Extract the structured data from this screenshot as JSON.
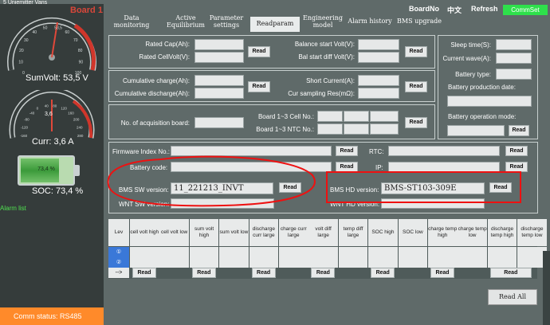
{
  "top_fragment": "5 Uniemitter Vans",
  "left": {
    "board_title": "Board 1",
    "sumvolt_gauge_ticks": [
      "0",
      "10",
      "20",
      "30",
      "40",
      "50",
      "53,5",
      "60",
      "70",
      "80",
      "90",
      "100"
    ],
    "sumvolt_gauge_value": 53.5,
    "sumvolt_label": "SumVolt: 53,5 V",
    "curr_gauge_ticks": [
      "-200",
      "-160",
      "-120",
      "-80",
      "-40",
      "0",
      "40",
      "80",
      "120",
      "160",
      "200",
      "240",
      "280",
      "320"
    ],
    "curr_gauge_center": "3,6",
    "curr_label": "Curr: 3,6 A",
    "battery_text": "73,4 %",
    "soc_fraction": 0.734,
    "soc_label": "SOC: 73,4 %",
    "alarm_list": "Alarm list",
    "comm_status": "Comm status: RS485"
  },
  "tabs": [
    {
      "label": "Data\nmonitoring"
    },
    {
      "label": "Active\nEquilibrium"
    },
    {
      "label": "Parameter\nsettings"
    },
    {
      "label": "Readparam"
    },
    {
      "label": "Engineering\nmodel"
    },
    {
      "label": "Alarm history"
    },
    {
      "label": "BMS upgrade"
    }
  ],
  "header": {
    "boardno": "BoardNo",
    "lang": "中文",
    "refresh": "Refresh",
    "commset": "CommSet"
  },
  "panel1": {
    "rated_cap": "Rated Cap(Ah):",
    "rated_cellvolt": "Rated CellVolt(V):",
    "balance_start": "Balance start Volt(V):",
    "bal_start_diff": "Bal start diff Volt(V):",
    "read": "Read"
  },
  "panel2": {
    "cum_charge": "Cumulative charge(Ah):",
    "cum_discharge": "Cumulative discharge(Ah):",
    "short_current": "Short Current(A):",
    "cur_sampling": "Cur sampling Res(mΩ):",
    "read": "Read"
  },
  "panel3": {
    "no_acq_board": "No. of acquisition board:",
    "board_cell_no": "Board 1~3 Cell No.:",
    "board_ntc_no": "Board 1~3 NTC No.:",
    "read": "Read"
  },
  "right_panel": {
    "sleep_time": "Sleep time(S):",
    "current_wave": "Current wave(A):",
    "battery_type": "Battery type:",
    "production_date": "Battery production date:",
    "operation_mode": "Battery operation mode:",
    "read": "Read"
  },
  "info": {
    "firmware_index": "Firmware Index No.:",
    "battery_code": "Battery code:",
    "bms_sw_version": "BMS SW version:",
    "bms_sw_value": "11_221213_INVT",
    "wnt_sw_version": "WNT SW version:",
    "rtc": "RTC:",
    "ip": "IP:",
    "bms_hd_version": "BMS HD version:",
    "bms_hd_value": "BMS-ST103-309E",
    "wnt_hd_version": "WNT HD version:",
    "read": "Read"
  },
  "grid": {
    "lev": "Lev",
    "headers": [
      "cell volt high",
      "cell volt low",
      "sum volt high",
      "sum volt low",
      "discharge curr large",
      "charge curr large",
      "volt diff large",
      "temp diff large",
      "SOC high",
      "SOC low",
      "charge temp high",
      "charge temp low",
      "discharge temp high",
      "discharge temp low"
    ],
    "row_labels": [
      "①",
      "②",
      "-->"
    ],
    "read": "Read"
  },
  "read_all": "Read All",
  "colors": {
    "accent_green": "#2ee04b",
    "comm_orange": "#ff8a2a",
    "board_red": "#d8473a",
    "annotation_red": "#e11"
  }
}
